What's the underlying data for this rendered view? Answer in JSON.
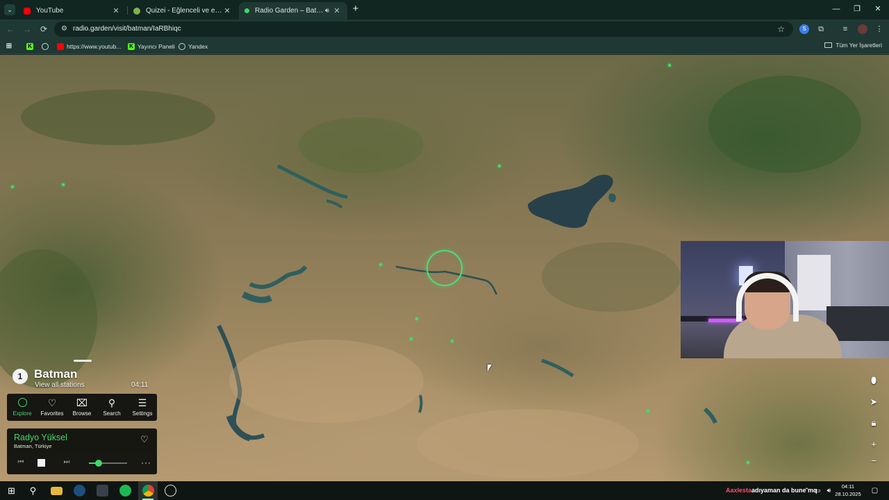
{
  "browser": {
    "tabs": [
      {
        "title": "YouTube",
        "favicon_color": "#ff0000"
      },
      {
        "title": "Quizei - Eğlenceli ve etkileşimli",
        "favicon_color": "#7fb24a"
      },
      {
        "title": "Radio Garden – Batman",
        "favicon_color": "#3fd86a"
      }
    ],
    "url": "radio.garden/visit/batman/IaRBhiqc",
    "bookmarks": [
      {
        "label": "",
        "icon": "kick-icon"
      },
      {
        "label": "",
        "icon": "globe-icon"
      },
      {
        "label": "https://www.youtub...",
        "icon": "youtube-icon"
      },
      {
        "label": "Yayıncı Paneli",
        "icon": "kick-icon"
      },
      {
        "label": "Yandex",
        "icon": "globe-icon"
      }
    ],
    "all_bookmarks_label": "Tüm Yer İşaretleri"
  },
  "place": {
    "count": "1",
    "title": "Batman",
    "subtitle": "View all stations",
    "time": "04:11"
  },
  "nav": {
    "explore": "Explore",
    "favorites": "Favorites",
    "browse": "Browse",
    "search": "Search",
    "settings": "Settings"
  },
  "player": {
    "station_name": "Radyo Yüksel",
    "station_location": "Batman, Türkiye",
    "volume": 0.25,
    "accent": "#3fd86a"
  },
  "taskbar": {
    "tray_user": "Aaxlesta",
    "tray_message": "adıyaman da bune mq",
    "time": "04:11",
    "date": "28.10.2025"
  }
}
